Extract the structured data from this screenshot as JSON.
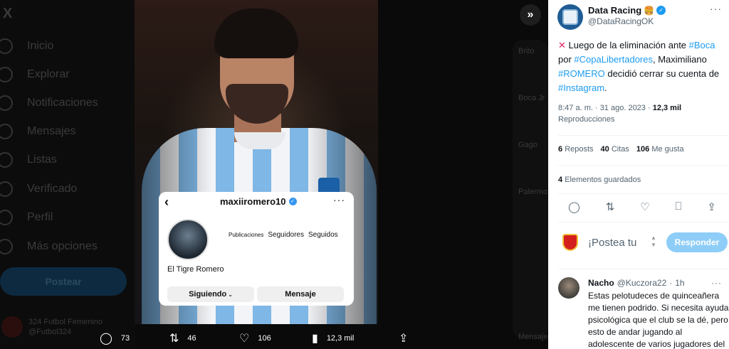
{
  "background_nav": {
    "logo": "X",
    "items": [
      "Inicio",
      "Explorar",
      "Notificaciones",
      "Mensajes",
      "Listas",
      "Verificado",
      "Perfil",
      "Más opciones"
    ],
    "post_button": "Postear",
    "account_name": "324 Futbol Femenino",
    "account_handle": "@Futbol324"
  },
  "background_trends": [
    "Brito",
    "Boca Jr",
    "Gago",
    "Palermo",
    "Mensajes"
  ],
  "instagram_card": {
    "username": "maxiiromero10",
    "stats": [
      "Publicaciones",
      "Seguidores",
      "Seguidos"
    ],
    "display_name": "El Tigre Romero",
    "follow_button": "Siguiendo",
    "message_button": "Mensaje"
  },
  "media_actions": {
    "replies": "73",
    "reposts": "46",
    "likes": "106",
    "views": "12,3 mil"
  },
  "tweet": {
    "author_name": "Data Racing",
    "author_handle": "@DataRacingOK",
    "text_parts": {
      "p1": "Luego de la eliminación ante ",
      "tag1": "#Boca",
      "p2": " por ",
      "tag2": "#CopaLibertadores",
      "p3": ", Maximiliano ",
      "tag3": "#ROMERO",
      "p4": " decidió cerrar su cuenta de ",
      "tag4": "#Instagram",
      "p5": "."
    },
    "time": "8:47 a. m. · 31 ago. 2023 · ",
    "views_count": "12,3 mil",
    "views_label": "Reproducciones",
    "reposts_count": "6",
    "reposts_label": "Reposts",
    "quotes_count": "40",
    "quotes_label": "Citas",
    "likes_count": "106",
    "likes_label": "Me gusta",
    "saved_count": "4",
    "saved_label": "Elementos guardados"
  },
  "compose": {
    "placeholder": "¡Postea tu",
    "button": "Responder"
  },
  "reply": {
    "name": "Nacho",
    "handle": "@Kuczora22",
    "time": "1h",
    "text": "Estas pelotudeces de quinceañera me tienen podrido. Si necesita ayuda psicológica que el club se la dé, pero esto de andar jugando al adolescente de varios jugadores del"
  },
  "colors": {
    "accent": "#1d9bf0",
    "reply_button": "#8ecdf8",
    "hashtag": "#1d9bf0"
  }
}
